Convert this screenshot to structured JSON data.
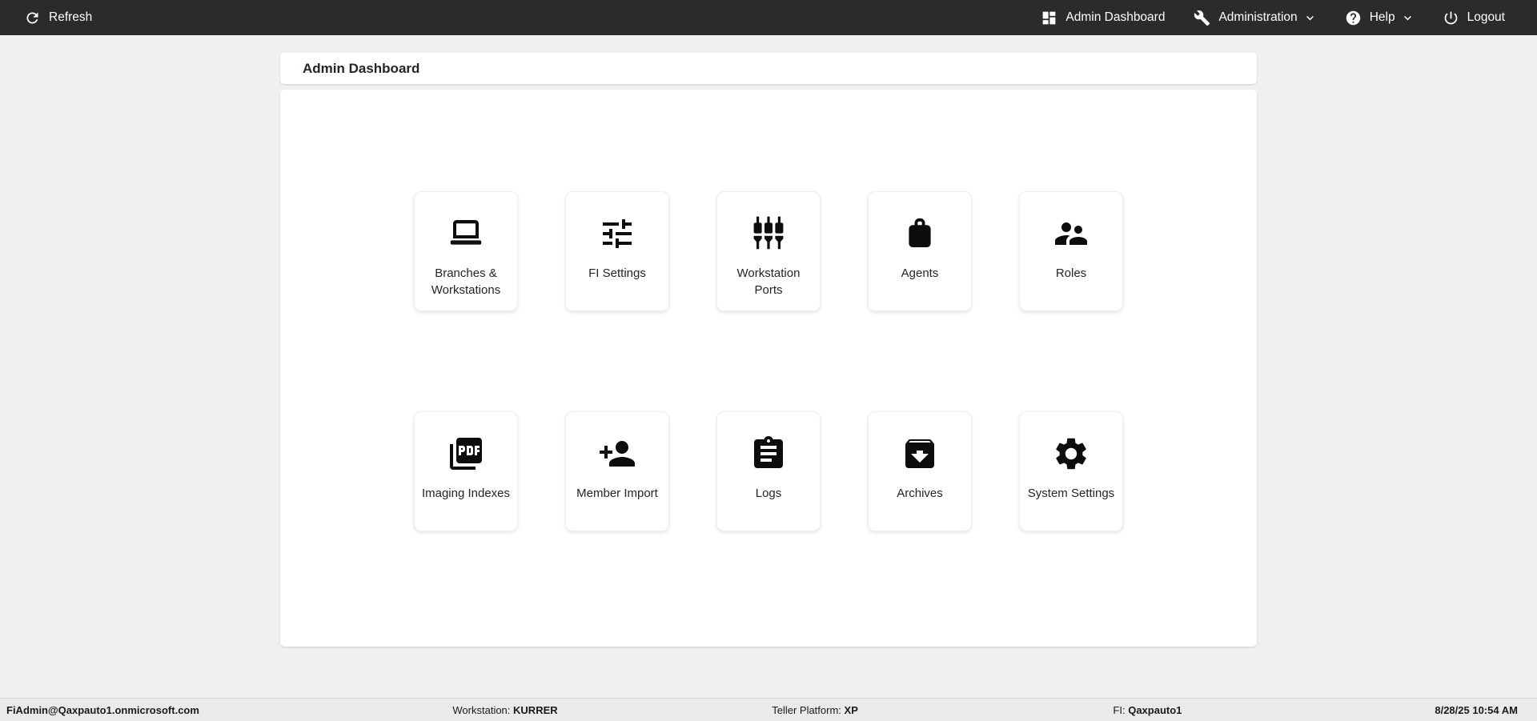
{
  "colors": {
    "topbar_bg": "#2b2b2b",
    "page_bg": "#f0f0f1",
    "card_bg": "#ffffff",
    "footer_bg": "#e9eaec",
    "text": "#212529"
  },
  "topbar": {
    "refresh_label": "Refresh",
    "nav": [
      {
        "label": "Admin Dashboard",
        "icon": "dashboard-icon",
        "has_dropdown": false
      },
      {
        "label": "Administration",
        "icon": "wrench-icon",
        "has_dropdown": true
      },
      {
        "label": "Help",
        "icon": "help-icon",
        "has_dropdown": true
      },
      {
        "label": "Logout",
        "icon": "power-icon",
        "has_dropdown": false
      }
    ]
  },
  "page": {
    "title": "Admin Dashboard"
  },
  "tiles": {
    "rows": [
      [
        {
          "id": "branches-workstations",
          "label": "Branches & Workstations",
          "icon": "laptop-icon"
        },
        {
          "id": "fi-settings",
          "label": "FI Settings",
          "icon": "sliders-icon"
        },
        {
          "id": "workstation-ports",
          "label": "Workstation Ports",
          "icon": "ports-icon"
        },
        {
          "id": "agents",
          "label": "Agents",
          "icon": "briefcase-icon"
        },
        {
          "id": "roles",
          "label": "Roles",
          "icon": "people-icon"
        }
      ],
      [
        {
          "id": "imaging-indexes",
          "label": "Imaging Indexes",
          "icon": "pdf-icon"
        },
        {
          "id": "member-import",
          "label": "Member Import",
          "icon": "person-add-icon"
        },
        {
          "id": "logs",
          "label": "Logs",
          "icon": "clipboard-icon"
        },
        {
          "id": "archives",
          "label": "Archives",
          "icon": "archive-icon"
        },
        {
          "id": "system-settings",
          "label": "System Settings",
          "icon": "gear-icon"
        }
      ]
    ]
  },
  "footer": {
    "user": "FiAdmin@Qaxpauto1.onmicrosoft.com",
    "workstation_label": "Workstation:",
    "workstation_value": "KURRER",
    "teller_platform_label": "Teller Platform:",
    "teller_platform_value": "XP",
    "fi_label": "FI:",
    "fi_value": "Qaxpauto1",
    "timestamp": "8/28/25 10:54 AM"
  }
}
